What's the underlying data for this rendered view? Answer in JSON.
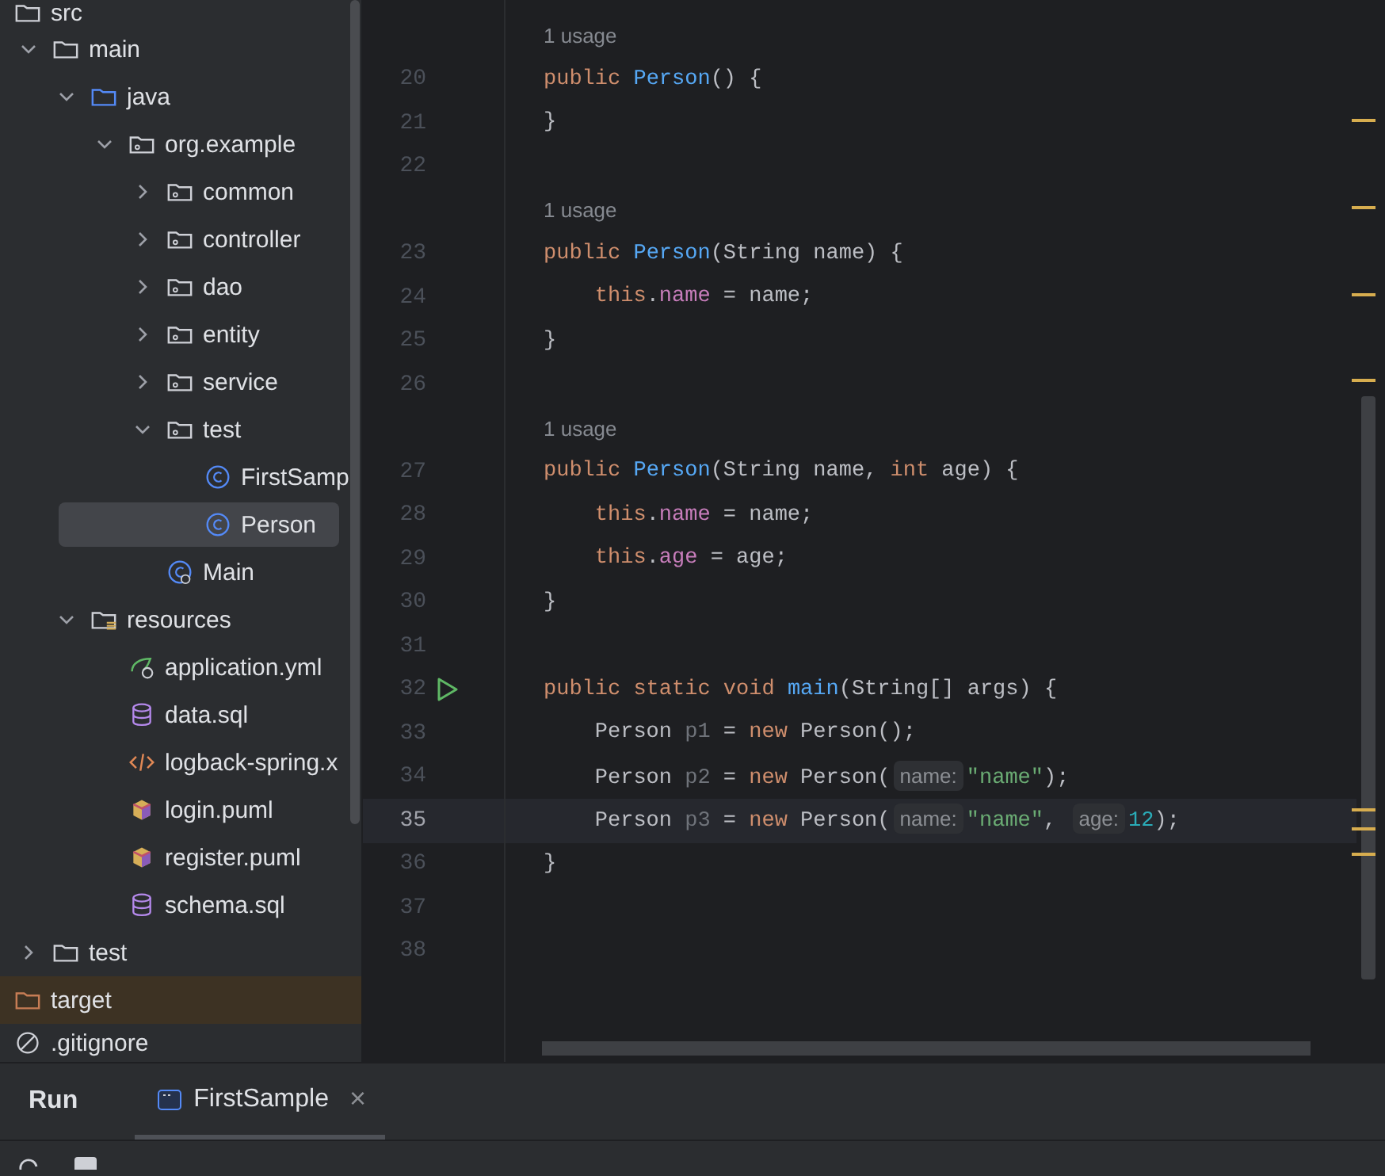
{
  "project_tree": {
    "nodes": [
      {
        "name": "src",
        "kind": "folder",
        "selected": false,
        "children": [
          {
            "name": "main",
            "kind": "folder",
            "expanded": true,
            "selected": false,
            "children": [
              {
                "name": "java",
                "kind": "source-folder",
                "expanded": true,
                "selected": false,
                "children": [
                  {
                    "name": "org.example",
                    "kind": "package",
                    "expanded": true,
                    "selected": false,
                    "children": [
                      {
                        "name": "common",
                        "kind": "package",
                        "expanded": false,
                        "selected": false
                      },
                      {
                        "name": "controller",
                        "kind": "package",
                        "expanded": false,
                        "selected": false
                      },
                      {
                        "name": "dao",
                        "kind": "package",
                        "expanded": false,
                        "selected": false
                      },
                      {
                        "name": "entity",
                        "kind": "package",
                        "expanded": false,
                        "selected": false
                      },
                      {
                        "name": "service",
                        "kind": "package",
                        "expanded": false,
                        "selected": false
                      },
                      {
                        "name": "test",
                        "kind": "package",
                        "expanded": true,
                        "selected": false,
                        "children": [
                          {
                            "name": "FirstSamp",
                            "kind": "class",
                            "selected": false
                          },
                          {
                            "name": "Person",
                            "kind": "class",
                            "selected": true
                          }
                        ]
                      },
                      {
                        "name": "Main",
                        "kind": "main-class",
                        "selected": false
                      }
                    ]
                  }
                ]
              },
              {
                "name": "resources",
                "kind": "resource-folder",
                "expanded": true,
                "selected": false,
                "children": [
                  {
                    "name": "application.yml",
                    "kind": "spring",
                    "selected": false
                  },
                  {
                    "name": "data.sql",
                    "kind": "database",
                    "selected": false
                  },
                  {
                    "name": "logback-spring.x",
                    "kind": "xml",
                    "selected": false
                  },
                  {
                    "name": "login.puml",
                    "kind": "puml",
                    "selected": false
                  },
                  {
                    "name": "register.puml",
                    "kind": "puml",
                    "selected": false
                  },
                  {
                    "name": "schema.sql",
                    "kind": "database",
                    "selected": false
                  }
                ]
              }
            ]
          },
          {
            "name": "test",
            "kind": "folder",
            "expanded": false,
            "selected": false
          }
        ]
      },
      {
        "name": "target",
        "kind": "excluded-folder",
        "selected": false
      },
      {
        "name": ".gitignore",
        "kind": "ignore",
        "selected": false
      }
    ]
  },
  "editor": {
    "rows": [
      {
        "kind": "usage",
        "text": "1 usage"
      },
      {
        "kind": "code",
        "number": "20",
        "current": false,
        "run": false,
        "tokens": [
          {
            "t": "public ",
            "kind": "kw"
          },
          {
            "t": "Person",
            "kind": "fn"
          },
          {
            "t": "() {",
            "kind": "plain"
          }
        ]
      },
      {
        "kind": "code",
        "number": "21",
        "current": false,
        "run": false,
        "tokens": [
          {
            "t": "}",
            "kind": "plain"
          }
        ]
      },
      {
        "kind": "code",
        "number": "22",
        "current": false,
        "run": false,
        "tokens": []
      },
      {
        "kind": "usage",
        "text": "1 usage"
      },
      {
        "kind": "code",
        "number": "23",
        "current": false,
        "run": false,
        "tokens": [
          {
            "t": "public ",
            "kind": "kw"
          },
          {
            "t": "Person",
            "kind": "fn"
          },
          {
            "t": "(String name) {",
            "kind": "plain"
          }
        ]
      },
      {
        "kind": "code",
        "number": "24",
        "current": false,
        "run": false,
        "tokens": [
          {
            "t": "    this",
            "kind": "kw"
          },
          {
            "t": ".",
            "kind": "plain"
          },
          {
            "t": "name",
            "kind": "field"
          },
          {
            "t": " = name;",
            "kind": "plain"
          }
        ]
      },
      {
        "kind": "code",
        "number": "25",
        "current": false,
        "run": false,
        "tokens": [
          {
            "t": "}",
            "kind": "plain"
          }
        ]
      },
      {
        "kind": "code",
        "number": "26",
        "current": false,
        "run": false,
        "tokens": []
      },
      {
        "kind": "usage",
        "text": "1 usage"
      },
      {
        "kind": "code",
        "number": "27",
        "current": false,
        "run": false,
        "tokens": [
          {
            "t": "public ",
            "kind": "kw"
          },
          {
            "t": "Person",
            "kind": "fn"
          },
          {
            "t": "(String name, ",
            "kind": "plain"
          },
          {
            "t": "int",
            "kind": "kw"
          },
          {
            "t": " age) {",
            "kind": "plain"
          }
        ]
      },
      {
        "kind": "code",
        "number": "28",
        "current": false,
        "run": false,
        "tokens": [
          {
            "t": "    this",
            "kind": "kw"
          },
          {
            "t": ".",
            "kind": "plain"
          },
          {
            "t": "name",
            "kind": "field"
          },
          {
            "t": " = name;",
            "kind": "plain"
          }
        ]
      },
      {
        "kind": "code",
        "number": "29",
        "current": false,
        "run": false,
        "tokens": [
          {
            "t": "    this",
            "kind": "kw"
          },
          {
            "t": ".",
            "kind": "plain"
          },
          {
            "t": "age",
            "kind": "field"
          },
          {
            "t": " = age;",
            "kind": "plain"
          }
        ]
      },
      {
        "kind": "code",
        "number": "30",
        "current": false,
        "run": false,
        "tokens": [
          {
            "t": "}",
            "kind": "plain"
          }
        ]
      },
      {
        "kind": "code",
        "number": "31",
        "current": false,
        "run": false,
        "tokens": []
      },
      {
        "kind": "code",
        "number": "32",
        "current": false,
        "run": true,
        "tokens": [
          {
            "t": "public static void ",
            "kind": "kw"
          },
          {
            "t": "main",
            "kind": "fn"
          },
          {
            "t": "(String[] args) {",
            "kind": "plain"
          }
        ]
      },
      {
        "kind": "code",
        "number": "33",
        "current": false,
        "run": false,
        "tokens": [
          {
            "t": "    Person ",
            "kind": "plain"
          },
          {
            "t": "p1",
            "kind": "unused"
          },
          {
            "t": " = ",
            "kind": "plain"
          },
          {
            "t": "new",
            "kind": "kw"
          },
          {
            "t": " Person();",
            "kind": "plain"
          }
        ]
      },
      {
        "kind": "code",
        "number": "34",
        "current": false,
        "run": false,
        "tokens": [
          {
            "t": "    Person ",
            "kind": "plain"
          },
          {
            "t": "p2",
            "kind": "unused"
          },
          {
            "t": " = ",
            "kind": "plain"
          },
          {
            "t": "new",
            "kind": "kw"
          },
          {
            "t": " Person(",
            "kind": "plain"
          },
          {
            "t": "name:",
            "kind": "hint"
          },
          {
            "t": "\"name\"",
            "kind": "str"
          },
          {
            "t": ");",
            "kind": "plain"
          }
        ]
      },
      {
        "kind": "code",
        "number": "35",
        "current": true,
        "run": false,
        "tokens": [
          {
            "t": "    Person ",
            "kind": "plain"
          },
          {
            "t": "p3",
            "kind": "unused"
          },
          {
            "t": " = ",
            "kind": "plain"
          },
          {
            "t": "new",
            "kind": "kw"
          },
          {
            "t": " Person(",
            "kind": "plain"
          },
          {
            "t": "name:",
            "kind": "hint"
          },
          {
            "t": "\"name\"",
            "kind": "str"
          },
          {
            "t": ", ",
            "kind": "plain"
          },
          {
            "t": "age:",
            "kind": "hint"
          },
          {
            "t": "12",
            "kind": "num"
          },
          {
            "t": ");",
            "kind": "plain"
          }
        ]
      },
      {
        "kind": "code",
        "number": "36",
        "current": false,
        "run": false,
        "tokens": [
          {
            "t": "}",
            "kind": "plain"
          }
        ]
      },
      {
        "kind": "code",
        "number": "37",
        "current": false,
        "run": false,
        "tokens": []
      },
      {
        "kind": "code",
        "number": "38",
        "current": false,
        "run": false,
        "tokens": []
      }
    ]
  },
  "run_panel": {
    "title": "Run",
    "tabs": [
      {
        "label": "FirstSample",
        "selected": true,
        "close": "×"
      }
    ]
  }
}
